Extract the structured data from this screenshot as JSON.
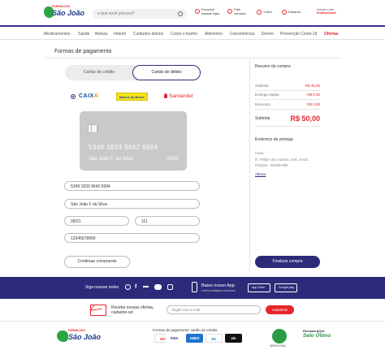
{
  "header": {
    "logo_top": "FARMÁCIAS",
    "logo_name": "São João",
    "search_placeholder": "o que você procura?",
    "stores_label": "Encontre nossas lojas",
    "contact_label": "Fale conosco",
    "cart_label": "1 item",
    "user_label": "Eduardo",
    "badge_top": "Acesse o site",
    "badge_bottom": "institucional"
  },
  "nav": {
    "items": [
      "Medicamentos",
      "Saúde",
      "Beleza",
      "Infantil",
      "Cuidados diários",
      "Corpo e banho",
      "Alimentos",
      "Conveniência",
      "Dermo",
      "Prevenção Covid-19",
      "Ofertas"
    ]
  },
  "payment": {
    "title": "Formas de pagamento",
    "tab_credit": "Cartão de crédito",
    "tab_debit": "Cartão de débito",
    "banks": {
      "caixa_a": "CAIX",
      "caixa_b": "A",
      "bb": "Banco do Brasil",
      "santander": "Santander"
    },
    "card": {
      "number": "5349 1833 9642 6994",
      "holder": "São João F. da Silva",
      "expiry": "09/21"
    },
    "fields": {
      "number": "5349 1833 9642 6994",
      "name": "São João F da Silva",
      "expiry": "09/21",
      "cvv": "111",
      "cpf": "12345678900"
    },
    "continue_label": "Continuar comprando",
    "finish_label": "Finalizar compra"
  },
  "summary": {
    "title": "Resumo da compra",
    "rows": [
      {
        "label": "Subtotal",
        "value": "R$ 45,00"
      },
      {
        "label": "Entrega rápida",
        "value": "R$ 5,00"
      },
      {
        "label": "Desconto",
        "value": "R$ 0,00"
      }
    ],
    "total_label": "Subtotal",
    "total_value": "R$ 50,00"
  },
  "address": {
    "title": "Endereço de entrega",
    "name": "Casa",
    "line1": "R. Felipe dos Santos, 546, Areal,",
    "line2": "Pelotas - 96080-590",
    "change": "Alterar"
  },
  "footer": {
    "social_label": "Siga nossas redes",
    "app_title": "Baixe nosso App",
    "app_sub": "e tenha vantagens exclusivas",
    "app_store": "App Store",
    "google_play": "Google play",
    "newsletter_line1": "Receba nossas ofertas,",
    "newsletter_line2": "cadastre-se!",
    "email_placeholder": "Digite seu e-mail",
    "subscribe_label": "cadastrar",
    "payment_title": "Formas de pagamento: cartão de crédito",
    "cards": [
      "MC",
      "VISA",
      "AMEX",
      "DC",
      "elo"
    ],
    "seal1": "ABRAFARMA",
    "seal2_top": "ReclameAQUI",
    "seal2_bottom": "Selo Ótimo"
  }
}
